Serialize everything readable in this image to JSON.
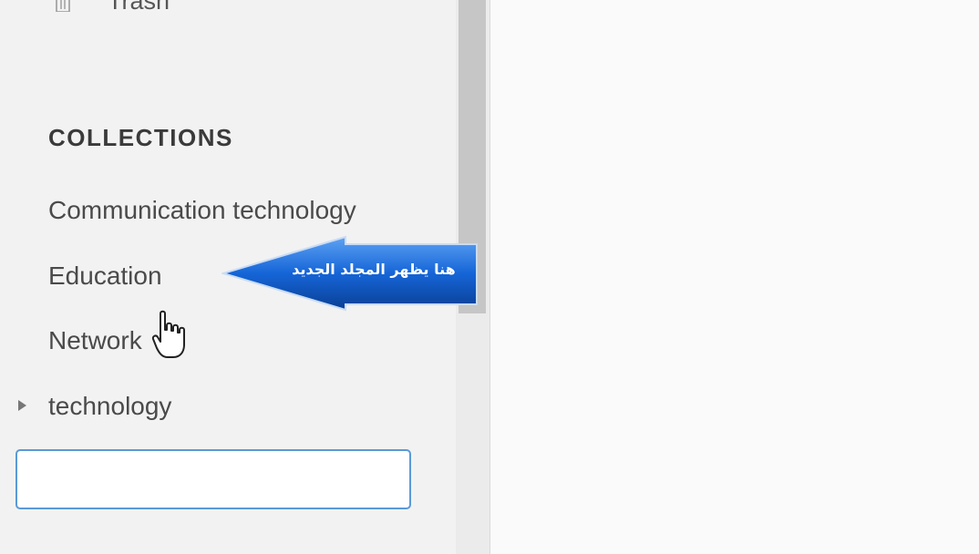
{
  "sidebar": {
    "top_item": {
      "label": "Trash",
      "icon": "trash-icon"
    },
    "collections_heading": "COLLECTIONS",
    "collections": [
      {
        "label": "Communication technology"
      },
      {
        "label": "Education"
      },
      {
        "label": "Network"
      },
      {
        "label": "technology",
        "expandable": true
      }
    ],
    "new_collection_input": {
      "value": "",
      "placeholder": ""
    }
  },
  "callout": {
    "text": "هنا يظهر المجلد الجديد",
    "color": "#1565d8"
  },
  "colors": {
    "sidebar_bg": "#f2f2f2",
    "input_border": "#5a9ad8",
    "scroll_thumb": "#c6c6c6"
  }
}
